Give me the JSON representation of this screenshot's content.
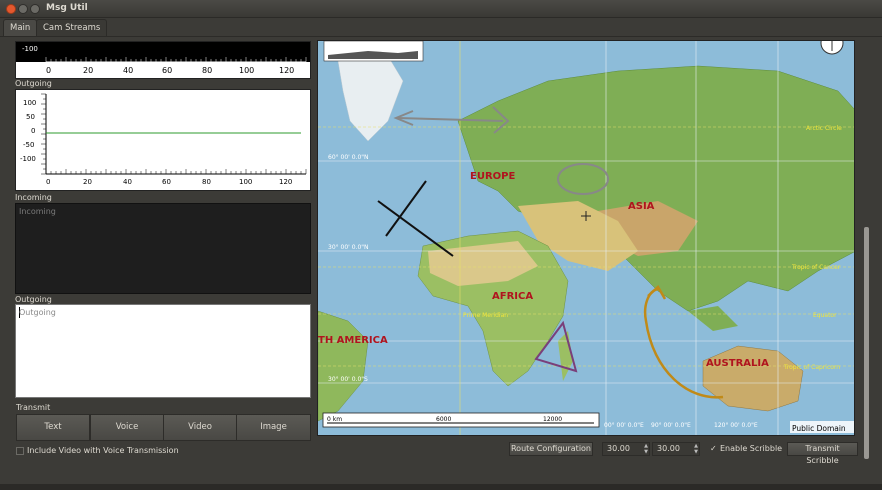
{
  "window": {
    "title": "Msg Util"
  },
  "tabs": [
    {
      "label": "Main"
    },
    {
      "label": "Cam Streams"
    }
  ],
  "left": {
    "top_plot": {
      "y_tick": "-100",
      "x_ticks": [
        "0",
        "20",
        "40",
        "60",
        "80",
        "100",
        "120"
      ]
    },
    "outgoing_label": "Outgoing",
    "outgoing_plot": {
      "y_ticks": [
        "100",
        "50",
        "0",
        "-50",
        "-100"
      ],
      "x_ticks": [
        "0",
        "20",
        "40",
        "60",
        "80",
        "100",
        "120"
      ]
    },
    "incoming_label": "Incoming",
    "incoming_placeholder": "Incoming",
    "outgoing_text_label": "Outgoing",
    "outgoing_placeholder": "Outgoing",
    "transmit_label": "Transmit",
    "buttons": {
      "text": "Text",
      "voice": "Voice",
      "video": "Video",
      "image": "Image"
    },
    "include_video_label": "Include Video with Voice Transmission"
  },
  "map": {
    "labels": {
      "europe": "EUROPE",
      "asia": "ASIA",
      "africa": "AFRICA",
      "south_america": "TH AMERICA",
      "australia": "AUSTRALIA"
    },
    "lines": {
      "arctic": "Arctic Circle",
      "cancer": "Tropic of Cancer",
      "prime": "Prime Meridian",
      "equator": "Equator",
      "capricorn": "Tropic of Capricorn"
    },
    "coords": {
      "lat60": "60° 00' 0.0\"N",
      "lat30": "30° 00' 0.0\"N",
      "lat30s": "30° 00' 0.0\"S",
      "lon0": "00° 00' 0.0\"E",
      "lon90": "90° 00' 0.0\"E",
      "lon120": "120° 00' 0.0\"E"
    },
    "scale": {
      "start": "0 km",
      "mid": "6000",
      "end": "12000"
    },
    "attribution": "Public Domain"
  },
  "controls": {
    "route_config": "Route Configuration",
    "spin1": "30.00",
    "spin2": "30.00",
    "enable_scribble": "Enable Scribble",
    "transmit_scribble": "Transmit Scribble"
  },
  "colors": {
    "accent_green": "#2e9b2e",
    "close_orange": "#e4582e"
  }
}
